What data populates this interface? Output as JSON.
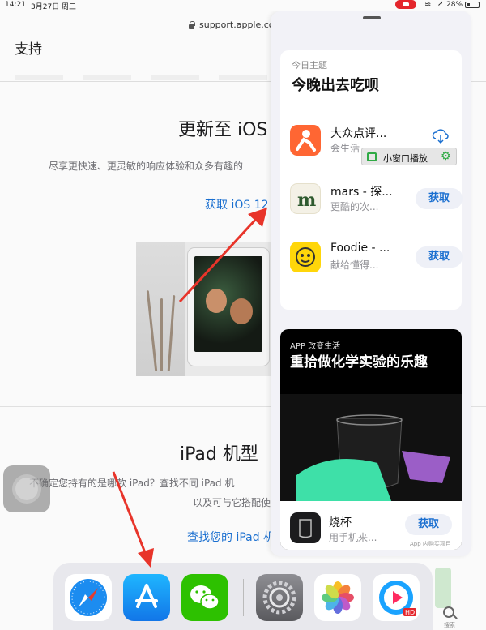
{
  "status_bar": {
    "time": "14:21",
    "date": "3月27日 周三",
    "url": "support.apple.com",
    "battery": "28%"
  },
  "browser": {
    "nav_title": "支持",
    "hero": {
      "title": "更新至 iOS",
      "description": "尽享更快速、更灵敏的响应体验和众多有趣的",
      "link": "获取 iOS 12"
    },
    "section": {
      "title": "iPad 机型",
      "description_line1": "不确定您持有的是哪款 iPad？查找不同 iPad 机",
      "description_line2": "以及可与它搭配使用",
      "link": "查找您的 iPad 机"
    }
  },
  "slide_over": {
    "today_card": {
      "subtitle": "今日主题",
      "title": "今晚出去吃呗",
      "apps": [
        {
          "name": "大众点评...",
          "subtitle": "会生活",
          "action": "download-cloud"
        },
        {
          "name": "mars - 探...",
          "subtitle": "更酷的次...",
          "action_label": "获取"
        },
        {
          "name": "Foodie - ...",
          "subtitle": "献给懂得...",
          "action_label": "获取"
        }
      ]
    },
    "pip_popup": {
      "label": "小窗口播放"
    },
    "story_card": {
      "subtitle": "APP 改变生活",
      "title": "重拾做化学实验的乐趣",
      "app": {
        "name": "烧杯",
        "subtitle": "用手机来...",
        "action_label": "获取",
        "note": "App 内购买项目"
      }
    }
  },
  "dock": {
    "apps": [
      "Safari",
      "App Store",
      "微信",
      "设置",
      "照片",
      "优酷"
    ],
    "search_label": "搜索"
  },
  "colors": {
    "link_blue": "#1a6fd0",
    "dianping_orange": "#ff6633",
    "foodie_yellow": "#ffd60a",
    "wechat_green": "#2dc100",
    "recording_red": "#e4262c"
  }
}
